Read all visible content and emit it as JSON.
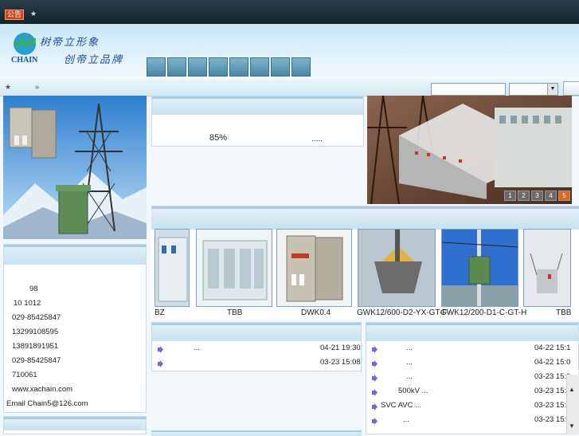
{
  "topbar": {
    "badge": "公告",
    "notice": "★"
  },
  "header": {
    "logo_text": "CHAIN",
    "slogan_line1": "树帝立形象",
    "slogan_line2": "创帝立品牌",
    "nav_tabs": [
      "",
      "",
      "",
      "",
      "",
      "",
      "",
      ""
    ]
  },
  "crumb": {
    "home": "★",
    "sep": "»"
  },
  "search": {
    "placeholder": "",
    "select_value": ""
  },
  "mid_panel": {
    "percent": "85%",
    "more": "....."
  },
  "slideshow": {
    "pages": [
      "1",
      "2",
      "3",
      "4",
      "5"
    ],
    "active": "5"
  },
  "contact": {
    "lines": [
      "98",
      "10 1012",
      "029-85425847",
      "13299108595",
      "13891891951",
      "029-85425847",
      "710061",
      "www.xachain.com",
      "Email Chain5@126.com"
    ]
  },
  "products": {
    "items": [
      {
        "label": "BZ"
      },
      {
        "label": "TBB"
      },
      {
        "label": "DWK0.4"
      },
      {
        "label": "GWK12/600-D2-YX-GT-F"
      },
      {
        "label": "GWK12/200-D1-C-GT-H"
      },
      {
        "label": "TBB"
      }
    ]
  },
  "news_left": [
    {
      "title": "...",
      "date": "04-21 19:30"
    },
    {
      "title": "",
      "date": "03-23 15:08"
    }
  ],
  "news_right": [
    {
      "title": "...",
      "date": "04-22 15:1"
    },
    {
      "title": "...",
      "date": "04-22 15:0"
    },
    {
      "title": "...",
      "date": "03-23 15:0"
    },
    {
      "title": "500kV ...",
      "date": "03-23 15:0"
    },
    {
      "title": "SVC AVC      ...",
      "date": "03-23 15:0"
    },
    {
      "title": "...",
      "date": "03-23 15:0"
    }
  ],
  "colors": {
    "accent": "#a9cde0",
    "brand": "#1b4fa0",
    "badge": "#d2461e"
  }
}
